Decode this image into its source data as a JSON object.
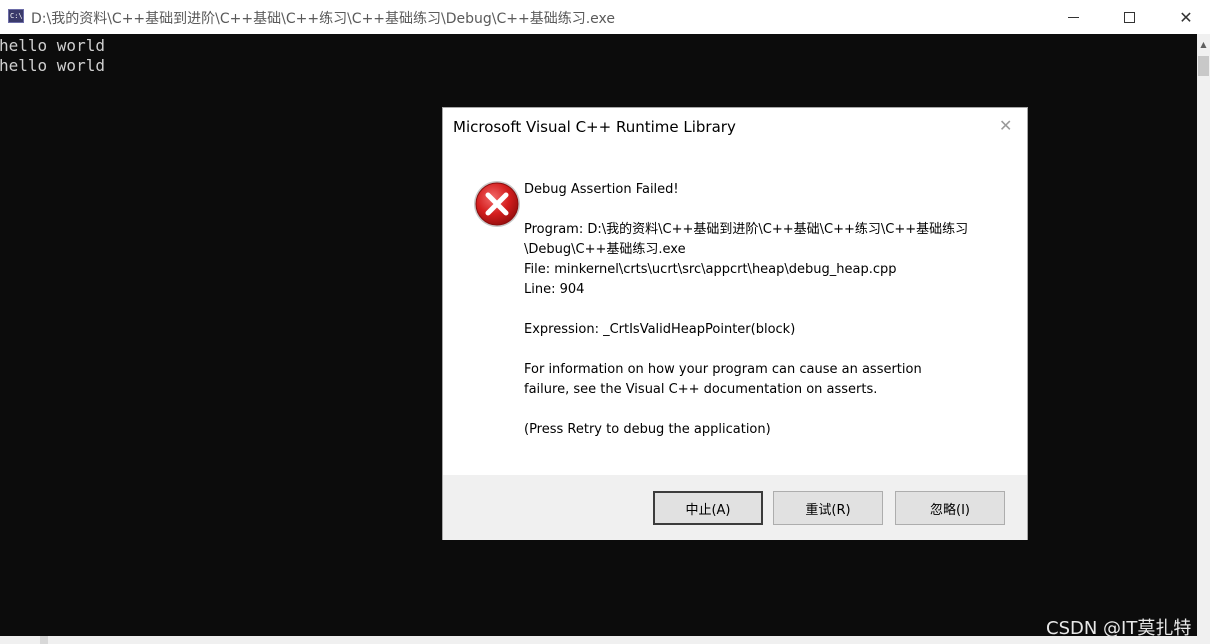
{
  "window": {
    "icon_text": "C:\\",
    "title": "D:\\我的资料\\C++基础到进阶\\C++基础\\C++练习\\C++基础练习\\Debug\\C++基础练习.exe"
  },
  "console": {
    "lines": [
      "hello world",
      "hello world"
    ]
  },
  "dialog": {
    "title": "Microsoft Visual C++ Runtime Library",
    "heading": "Debug Assertion Failed!",
    "program_line1": "Program: D:\\我的资料\\C++基础到进阶\\C++基础\\C++练习\\C++基础练习",
    "program_line2": "\\Debug\\C++基础练习.exe",
    "file": "File: minkernel\\crts\\ucrt\\src\\appcrt\\heap\\debug_heap.cpp",
    "line": "Line: 904",
    "expression": "Expression: _CrtIsValidHeapPointer(block)",
    "info_line1": "For information on how your program can cause an assertion",
    "info_line2": "failure, see the Visual C++ documentation on asserts.",
    "retry_hint": "(Press Retry to debug the application)",
    "buttons": {
      "abort": "中止(A)",
      "retry": "重试(R)",
      "ignore": "忽略(I)"
    }
  },
  "watermark": "CSDN @IT莫扎特",
  "colors": {
    "console_bg": "#0c0c0c",
    "console_text": "#d0d0d0",
    "error_red": "#d41e1e"
  },
  "icons": {
    "app": "console-app-icon",
    "error": "error-x-icon",
    "close": "close-icon"
  }
}
